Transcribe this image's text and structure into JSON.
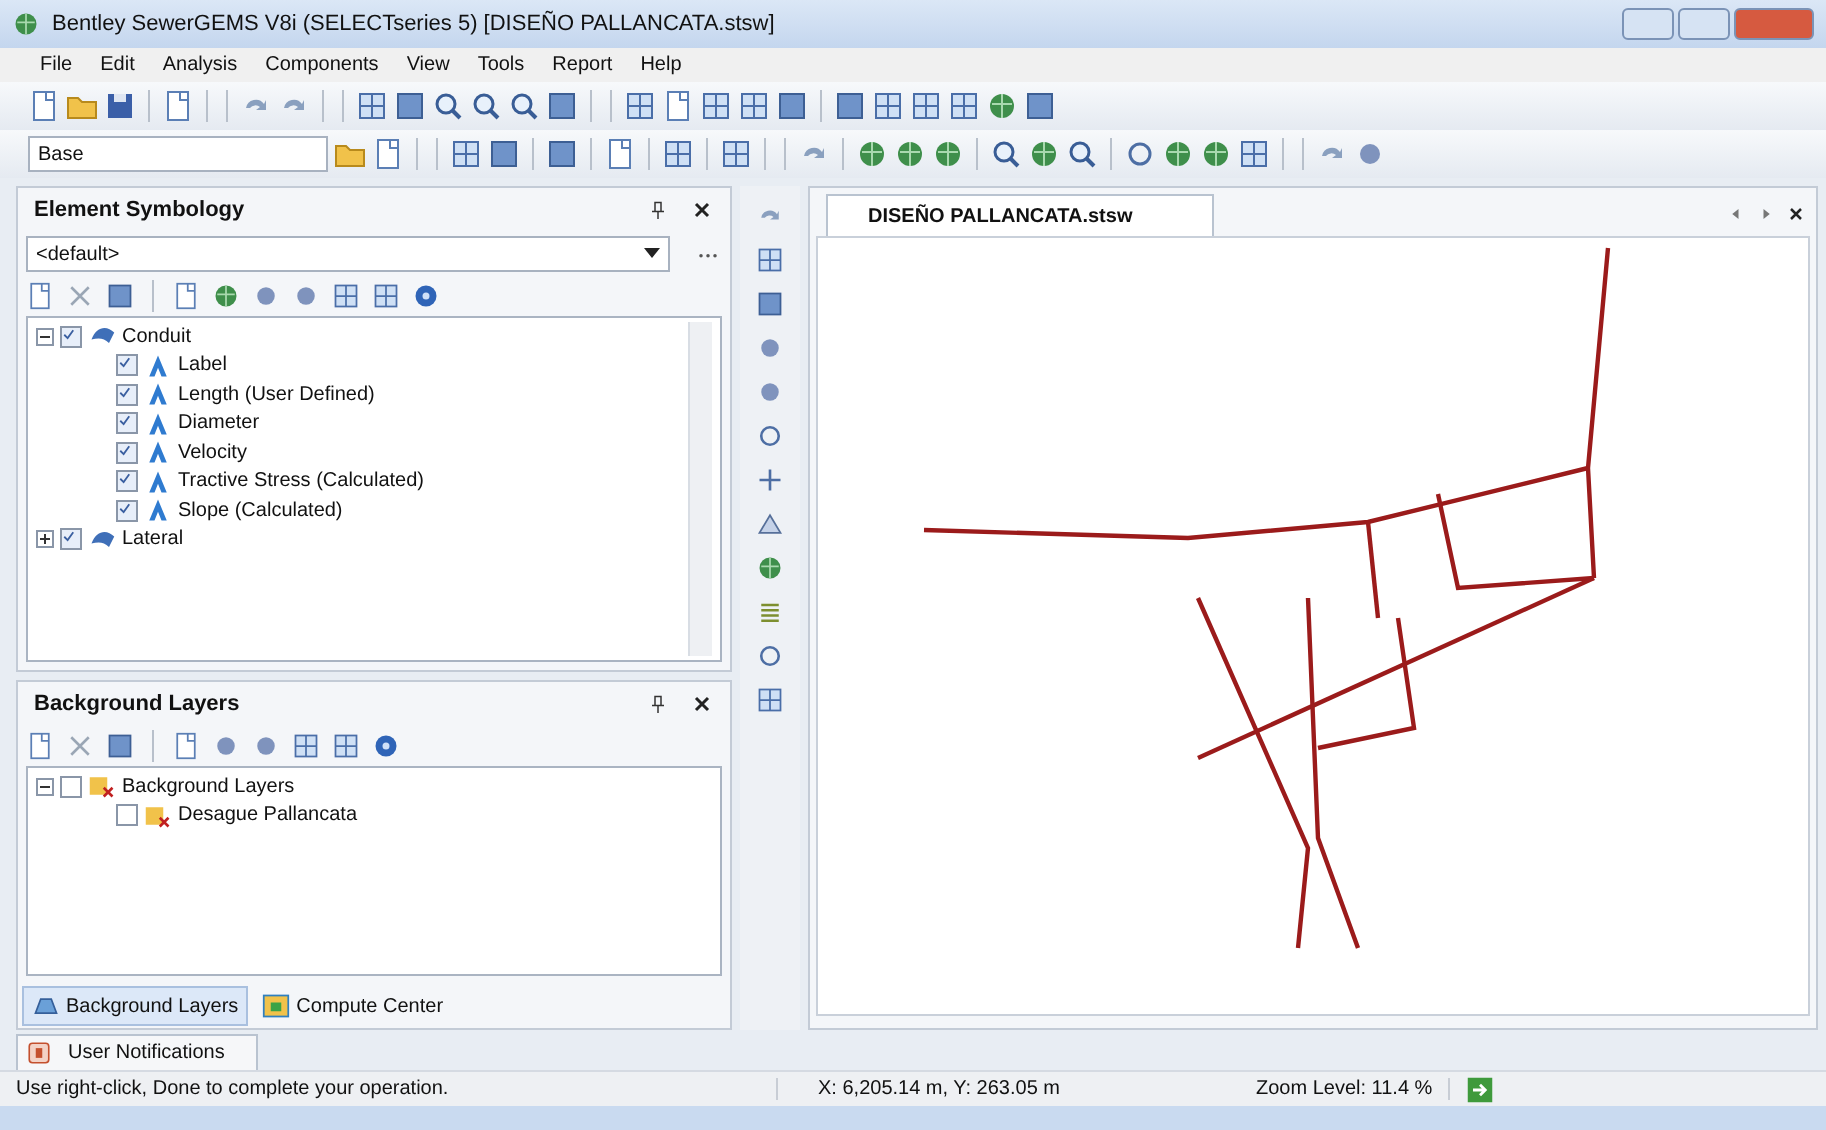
{
  "window": {
    "title": "Bentley SewerGEMS V8i (SELECTseries 5) [DISEÑO PALLANCATA.stsw]"
  },
  "menu": [
    "File",
    "Edit",
    "Analysis",
    "Components",
    "View",
    "Tools",
    "Report",
    "Help"
  ],
  "toolbar": {
    "scenario_combo": "Base"
  },
  "element_symbology": {
    "title": "Element Symbology",
    "combo": "<default>",
    "tree": [
      {
        "label": "Conduit",
        "checked": true,
        "expanded": true,
        "children": [
          {
            "label": "Label",
            "checked": true
          },
          {
            "label": "Length (User Defined)",
            "checked": true
          },
          {
            "label": "Diameter",
            "checked": true
          },
          {
            "label": "Velocity",
            "checked": true
          },
          {
            "label": "Tractive Stress (Calculated)",
            "checked": true
          },
          {
            "label": "Slope (Calculated)",
            "checked": true
          }
        ]
      },
      {
        "label": "Lateral",
        "checked": true,
        "expanded": false
      }
    ]
  },
  "background_layers": {
    "title": "Background Layers",
    "tree": [
      {
        "label": "Background Layers",
        "checked": false,
        "expanded": true,
        "children": [
          {
            "label": "Desague Pallancata",
            "checked": false
          }
        ]
      }
    ]
  },
  "panel_tabs": [
    {
      "label": "Background Layers",
      "selected": true
    },
    {
      "label": "Compute Center",
      "selected": false
    }
  ],
  "document_tab": {
    "label": "DISEÑO PALLANCATA.stsw"
  },
  "notifications_tab": {
    "label": "User Notifications"
  },
  "status_bar": {
    "message": "Use right-click, Done to complete your operation.",
    "coordinates": "X: 6,205.14 m, Y: 263.05 m",
    "zoom": "Zoom Level: 11.4 %"
  }
}
